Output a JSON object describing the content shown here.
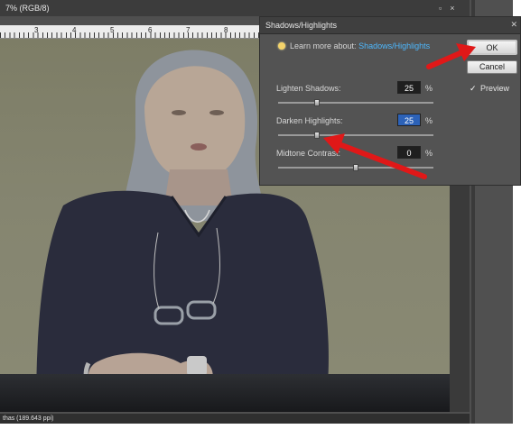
{
  "document": {
    "title": "7% (RGB/8)",
    "status_text": "thas (189.643 ppi)",
    "ruler_numbers": [
      "3",
      "4",
      "5",
      "6",
      "7",
      "8"
    ]
  },
  "dialog": {
    "title": "Shadows/Highlights",
    "learn_prefix": "Learn more about:",
    "learn_link": "Shadows/Highlights",
    "ok_label": "OK",
    "cancel_label": "Cancel",
    "preview_label": "Preview",
    "preview_checked": true,
    "controls": [
      {
        "label": "Lighten Shadows:",
        "value": "25",
        "unit": "%",
        "level": 0.25
      },
      {
        "label": "Darken Highlights:",
        "value": "25",
        "unit": "%",
        "level": 0.25,
        "selected": true
      },
      {
        "label": "Midtone Contrast:",
        "value": "0",
        "unit": "%",
        "level": 0.5
      }
    ]
  },
  "colors": {
    "link": "#4db8ff",
    "annotation_arrow": "#e01818",
    "dialog_bg": "#535353"
  },
  "icons": {
    "info": "lightbulb-icon",
    "close": "close-icon",
    "check": "checkmark-icon"
  }
}
